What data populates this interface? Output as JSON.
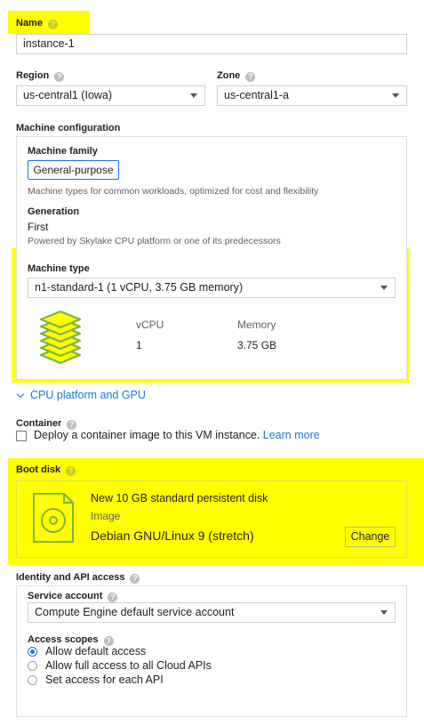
{
  "name": {
    "label": "Name",
    "value": "instance-1"
  },
  "region": {
    "label": "Region",
    "value": "us-central1 (Iowa)"
  },
  "zone": {
    "label": "Zone",
    "value": "us-central1-a"
  },
  "machine_configuration": {
    "label": "Machine configuration",
    "family_label": "Machine family",
    "family_tab": "General-purpose",
    "family_desc": "Machine types for common workloads, optimized for cost and flexibility",
    "generation_label": "Generation",
    "generation_value": "First",
    "generation_desc": "Powered by Skylake CPU platform or one of its predecessors",
    "type_label": "Machine type",
    "type_value": "n1-standard-1 (1 vCPU, 3.75 GB memory)",
    "vcpu_header": "vCPU",
    "vcpu_value": "1",
    "memory_header": "Memory",
    "memory_value": "3.75 GB",
    "cpu_platform_link": "CPU platform and GPU"
  },
  "container": {
    "label": "Container",
    "checkbox_text": "Deploy a container image to this VM instance.",
    "learn_more": "Learn more"
  },
  "boot_disk": {
    "label": "Boot disk",
    "title": "New 10 GB standard persistent disk",
    "image_label": "Image",
    "image_value": "Debian GNU/Linux 9 (stretch)",
    "change_button": "Change"
  },
  "identity": {
    "label": "Identity and API access",
    "service_account_label": "Service account",
    "service_account_value": "Compute Engine default service account",
    "scopes_label": "Access scopes",
    "scopes": [
      {
        "label": "Allow default access",
        "selected": true
      },
      {
        "label": "Allow full access to all Cloud APIs",
        "selected": false
      },
      {
        "label": "Set access for each API",
        "selected": false
      }
    ]
  },
  "help_glyph": "?",
  "colors": {
    "highlight": "#ffff00",
    "accent": "#1a73e8",
    "icon_green": "#8bc34a"
  },
  "icons": [
    "help-icon",
    "layers-icon",
    "chevron-down-icon",
    "disk-icon",
    "dropdown-caret-icon"
  ]
}
